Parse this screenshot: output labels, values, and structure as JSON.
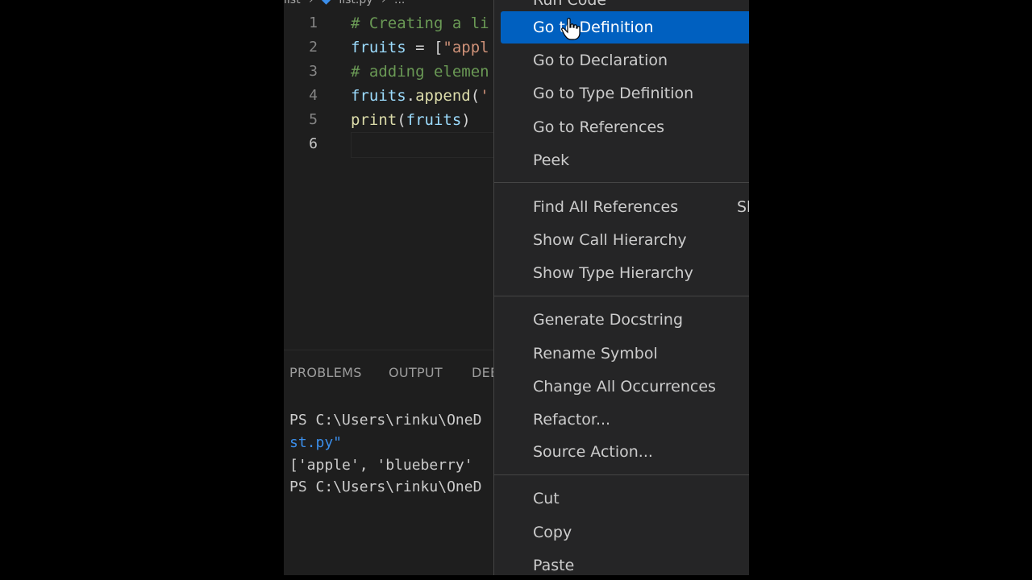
{
  "breadcrumb": {
    "folder": "list",
    "file": "list.py",
    "more": "..."
  },
  "editor": {
    "line_numbers": [
      "1",
      "2",
      "3",
      "4",
      "5",
      "6"
    ],
    "lines": [
      {
        "parts": [
          {
            "cls": "cm",
            "text": "# Creating a li"
          }
        ]
      },
      {
        "parts": [
          {
            "cls": "vr",
            "text": "fruits"
          },
          {
            "cls": "op",
            "text": " = ["
          },
          {
            "cls": "st",
            "text": "\"appl"
          }
        ]
      },
      {
        "parts": [
          {
            "cls": "cm",
            "text": "# adding elemen"
          }
        ]
      },
      {
        "parts": [
          {
            "cls": "vr",
            "text": "fruits"
          },
          {
            "cls": "op",
            "text": "."
          },
          {
            "cls": "fn",
            "text": "append"
          },
          {
            "cls": "op",
            "text": "("
          },
          {
            "cls": "st",
            "text": "'"
          }
        ]
      },
      {
        "parts": [
          {
            "cls": "fn",
            "text": "print"
          },
          {
            "cls": "op",
            "text": "("
          },
          {
            "cls": "vr",
            "text": "fruits"
          },
          {
            "cls": "op",
            "text": ")"
          }
        ]
      },
      {
        "parts": []
      }
    ]
  },
  "panel": {
    "tabs": [
      "PROBLEMS",
      "OUTPUT",
      "DEE"
    ],
    "terminal": [
      "PS C:\\Users\\rinku\\OneD",
      "st.py\"",
      "['apple', 'blueberry'",
      "PS C:\\Users\\rinku\\OneD"
    ]
  },
  "menu": {
    "top_partial": "Run Code",
    "items": [
      {
        "label": "Go to Definition",
        "selected": true
      },
      {
        "label": "Go to Declaration"
      },
      {
        "label": "Go to Type Definition"
      },
      {
        "label": "Go to References"
      },
      {
        "label": "Peek"
      },
      {
        "label": "Find All References",
        "key": "Sh"
      },
      {
        "label": "Show Call Hierarchy"
      },
      {
        "label": "Show Type Hierarchy"
      },
      {
        "label": "Generate Docstring"
      },
      {
        "label": "Rename Symbol"
      },
      {
        "label": "Change All Occurrences"
      },
      {
        "label": "Refactor..."
      },
      {
        "label": "Source Action..."
      },
      {
        "label": "Cut"
      },
      {
        "label": "Copy"
      },
      {
        "label": "Paste"
      }
    ]
  },
  "colors": {
    "selection": "#0060c0",
    "background": "#1e1e1e",
    "menu_bg": "#252526"
  }
}
